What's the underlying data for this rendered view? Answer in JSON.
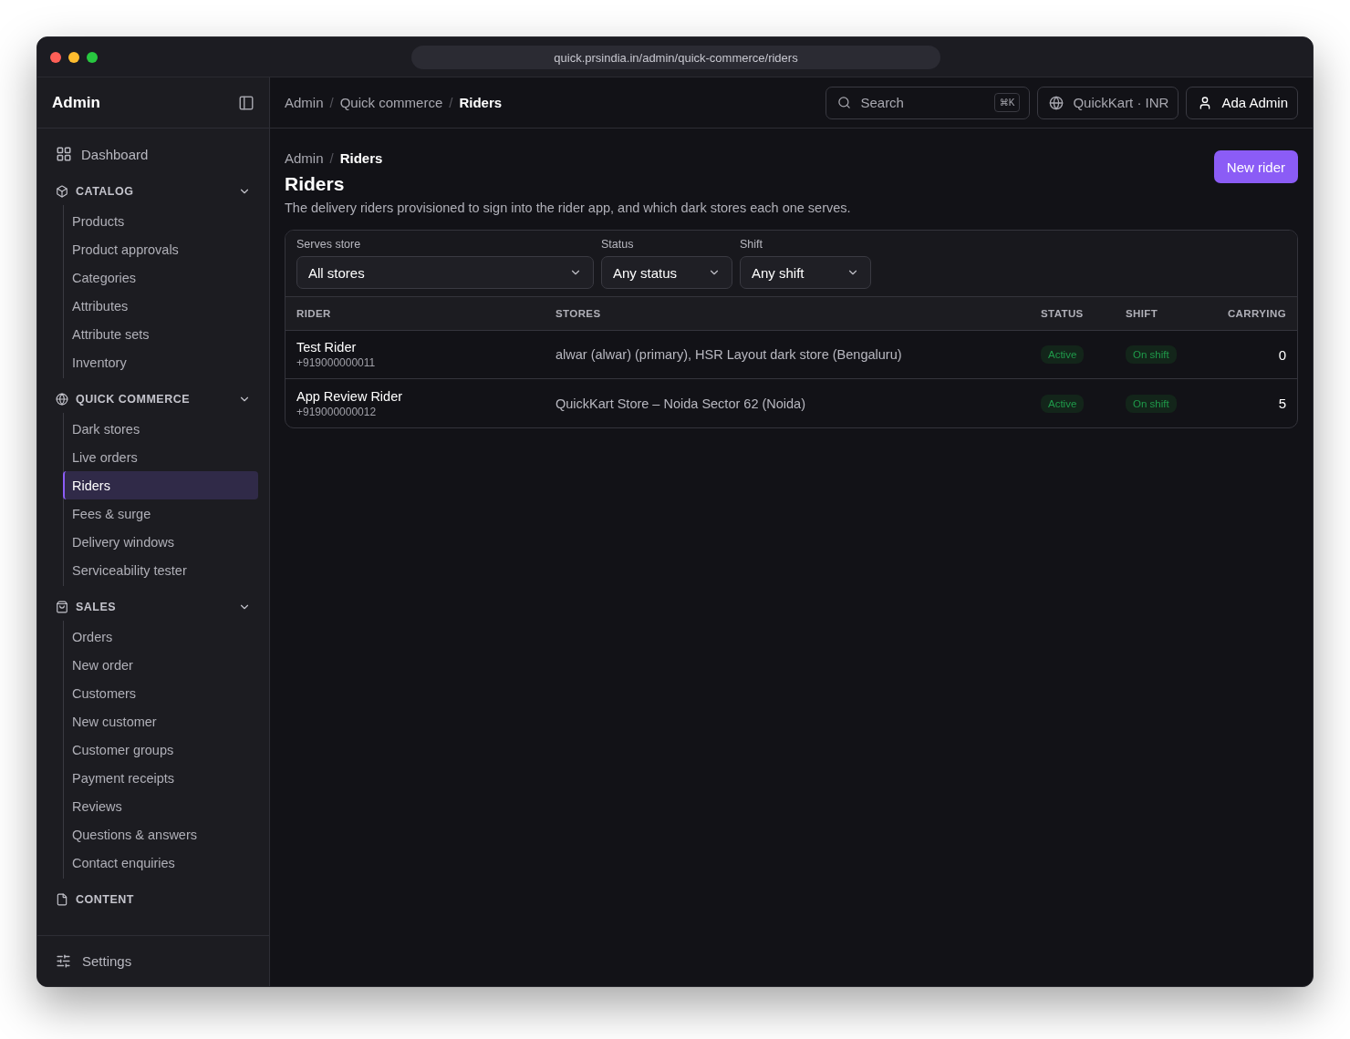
{
  "browser": {
    "url": "quick.prsindia.in/admin/quick-commerce/riders"
  },
  "sidebar": {
    "title": "Admin",
    "dashboard": {
      "label": "Dashboard",
      "selected": false
    },
    "sections": [
      {
        "title": "CATALOG",
        "expanded": true,
        "items": [
          {
            "label": "Products",
            "selected": false
          },
          {
            "label": "Product approvals",
            "selected": false
          },
          {
            "label": "Categories",
            "selected": false
          },
          {
            "label": "Attributes",
            "selected": false
          },
          {
            "label": "Attribute sets",
            "selected": false
          },
          {
            "label": "Inventory",
            "selected": false
          }
        ]
      },
      {
        "title": "QUICK COMMERCE",
        "expanded": true,
        "items": [
          {
            "label": "Dark stores",
            "selected": false
          },
          {
            "label": "Live orders",
            "selected": false
          },
          {
            "label": "Riders",
            "selected": true
          },
          {
            "label": "Fees & surge",
            "selected": false
          },
          {
            "label": "Delivery windows",
            "selected": false
          },
          {
            "label": "Serviceability tester",
            "selected": false
          }
        ]
      },
      {
        "title": "SALES",
        "expanded": true,
        "items": [
          {
            "label": "Orders",
            "selected": false
          },
          {
            "label": "New order",
            "selected": false
          },
          {
            "label": "Customers",
            "selected": false
          },
          {
            "label": "New customer",
            "selected": false
          },
          {
            "label": "Customer groups",
            "selected": false
          },
          {
            "label": "Payment receipts",
            "selected": false
          },
          {
            "label": "Reviews",
            "selected": false
          },
          {
            "label": "Questions & answers",
            "selected": false
          },
          {
            "label": "Contact enquiries",
            "selected": false
          }
        ]
      },
      {
        "title": "CONTENT",
        "expanded": false
      }
    ],
    "settings": "Settings"
  },
  "header": {
    "breadcrumbs": [
      "Admin",
      "Quick commerce",
      "Riders"
    ],
    "separator": "/",
    "search": {
      "placeholder": "Search",
      "shortcut": "⌘K"
    },
    "store": "QuickKart · INR",
    "user": "Ada Admin"
  },
  "page": {
    "breadcrumbs": [
      "Admin",
      "Riders"
    ],
    "separator": "/",
    "title": "Riders",
    "description": "The delivery riders provisioned to sign into the rider app, and which dark stores each one serves.",
    "action": "New rider"
  },
  "filters": [
    {
      "label": "Serves store",
      "value": "All stores"
    },
    {
      "label": "Status",
      "value": "Any status"
    },
    {
      "label": "Shift",
      "value": "Any shift"
    }
  ],
  "table": {
    "columns": [
      "RIDER",
      "STORES",
      "STATUS",
      "SHIFT",
      "CARRYING"
    ],
    "rows": [
      {
        "name": "Test Rider",
        "phone": "+919000000011",
        "stores": "alwar (alwar) (primary), HSR Layout dark store (Bengaluru)",
        "status": "Active",
        "shift": "On shift",
        "carrying": "0"
      },
      {
        "name": "App Review Rider",
        "phone": "+919000000012",
        "stores": "QuickKart Store – Noida Sector 62 (Noida)",
        "status": "Active",
        "shift": "On shift",
        "carrying": "5"
      }
    ]
  }
}
